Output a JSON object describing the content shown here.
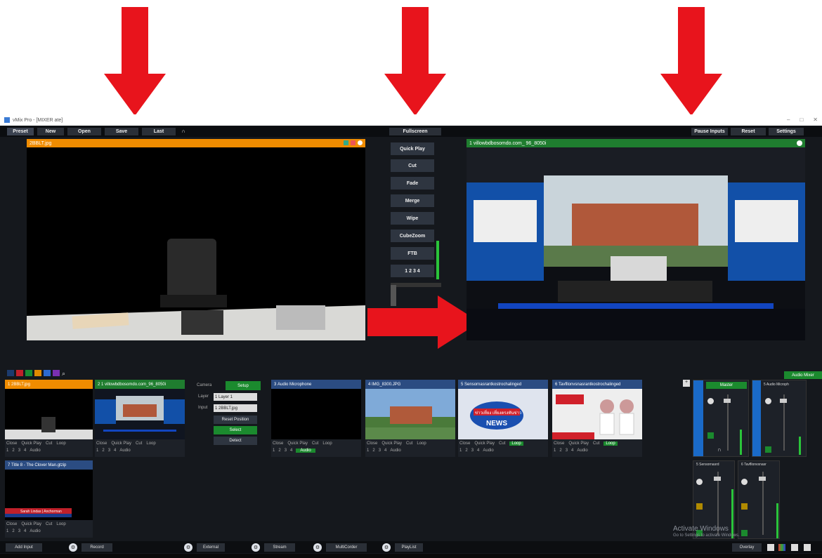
{
  "window": {
    "title": "vMix Pro - [MIXER ate]",
    "controls": [
      "–",
      "□",
      "✕"
    ]
  },
  "menu": {
    "preset": "Preset",
    "new": "New",
    "open": "Open",
    "save": "Save",
    "last": "Last",
    "fullscreen": "Fullscreen",
    "pause_inputs": "Pause Inputs",
    "restart": "Reset",
    "settings": "Settings"
  },
  "preview": {
    "title": "2BBLT.jpg"
  },
  "output": {
    "title": "1 villowbdbosomdo.com_ 96_8050i"
  },
  "transitions": {
    "quick_play": "Quick Play",
    "cut": "Cut",
    "fade": "Fade",
    "merge": "Merge",
    "wipe": "Wipe",
    "cube_zoom": "CubeZoom",
    "stinger": "FTB",
    "numbers": "1 2 3 4"
  },
  "inputs": [
    {
      "num": "1",
      "title": "2BBLT.jpg",
      "color": "#f08c00"
    },
    {
      "num": "2",
      "title": "1 villowbdbosomdo.com_96_8050i",
      "color": "#1f6b2f"
    },
    {
      "num": "3",
      "title": "Audio Microphone",
      "color": "#2b4c82"
    },
    {
      "num": "4",
      "title": "IMG_8300.JPG",
      "color": "#2b4c82"
    },
    {
      "num": "5",
      "title": "Sensornasrantkostrochalinged",
      "color": "#2b4c82"
    },
    {
      "num": "6",
      "title": "Tavfllonvsnasrantkostrochalinged",
      "color": "#2b4c82"
    },
    {
      "num": "7",
      "title": "Title 8 - The Clover Man.gtzip",
      "color": "#2b4c82"
    }
  ],
  "input_ctrls": {
    "close": "Close",
    "quick_play": "Quick Play",
    "cut": "Cut",
    "loop": "Loop",
    "audio": "Audio",
    "nums": [
      "1",
      "2",
      "3",
      "4"
    ]
  },
  "camera": {
    "label": "Camera",
    "setup": "Setup",
    "layer_label": "Layer",
    "layer_value": "1 Layer 1",
    "input_label": "Input",
    "input_value": "1 2BBLT.jpg",
    "reset": "Reset Position",
    "select": "Select",
    "detect": "Detect"
  },
  "audio": {
    "mixer": "Audio Mixer",
    "master": "Master",
    "ch1": "5 Audio Microph",
    "ch2": "5 Sensornasrd",
    "ch3": "6 Tavfllonvsnasr",
    "headphones": "Headphones",
    "master_label": "MASTER"
  },
  "bottom": {
    "add_input": "Add Input",
    "record": "Record",
    "external": "External",
    "stream": "Stream",
    "multicorder": "MultiCorder",
    "playlist": "PlayList",
    "overlay": "Overlay"
  },
  "watermark": {
    "line1": "Activate Windows",
    "line2": "Go to Settings to activate Windows."
  },
  "thumb_texts": {
    "news_logo": "ข่าวเที่ยง เที่ยงตรงทันข่าว",
    "news_big": "NEWS",
    "lower_third": "Sarah Lindas | Anchorman"
  },
  "colors": {
    "accent": "#f08c00",
    "live": "#1f7d2f",
    "input_blue": "#2b4c82",
    "arrow": "#e8141c"
  }
}
